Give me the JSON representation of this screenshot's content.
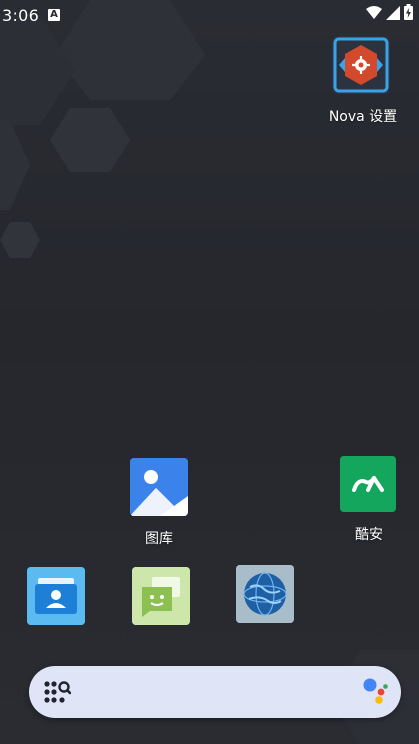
{
  "status_bar": {
    "time": "3:06",
    "notification_letter": "A",
    "icons": [
      "wifi-icon",
      "signal-icon",
      "battery-charging-icon"
    ]
  },
  "apps": {
    "nova_settings": {
      "label": "Nova 设置",
      "icon": "nova-settings-icon",
      "color": "#cf4a2b"
    },
    "gallery": {
      "label": "图库",
      "icon": "gallery-icon",
      "color": "#3d7ee8"
    },
    "coolapk": {
      "label": "酷安",
      "icon": "coolapk-icon",
      "color": "#12a35a"
    }
  },
  "dock": [
    {
      "name": "contacts",
      "icon": "contacts-icon",
      "color": "#2f8fe0"
    },
    {
      "name": "messages",
      "icon": "messages-icon",
      "color": "#8cc152"
    },
    {
      "name": "browser",
      "icon": "globe-icon",
      "color": "#2a6fb0"
    }
  ],
  "search_bar": {
    "left_icon": "app-drawer-search-icon",
    "right_icon": "google-assistant-icon",
    "assistant_colors": [
      "#4285f4",
      "#ea4335",
      "#fbbc05",
      "#34a853"
    ]
  }
}
